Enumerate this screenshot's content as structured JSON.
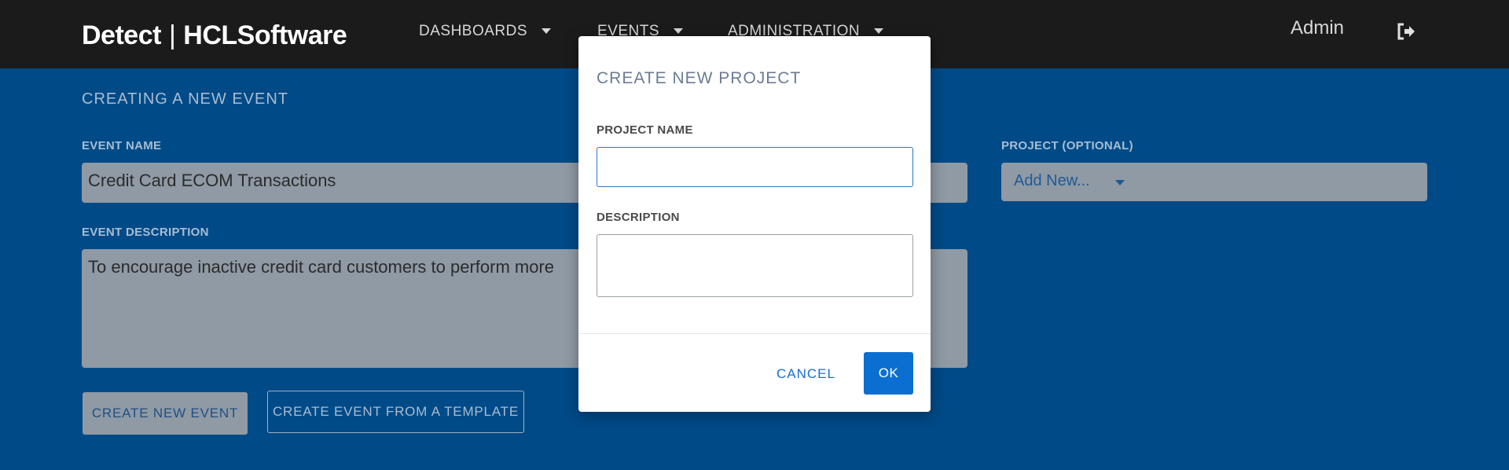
{
  "header": {
    "logo_left": "Detect",
    "logo_sep": "|",
    "logo_right": "HCLSoftware",
    "nav": [
      "DASHBOARDS",
      "EVENTS",
      "ADMINISTRATION"
    ],
    "user": "Admin",
    "logout_icon": "logout-icon"
  },
  "form": {
    "title": "CREATING A NEW EVENT",
    "event_name_label": "EVENT NAME",
    "event_name_value": "Credit Card ECOM  Transactions",
    "project_label": "PROJECT (OPTIONAL)",
    "project_value": "Add New...",
    "description_label": "EVENT DESCRIPTION",
    "description_value": "To encourage inactive credit card customers to perform more",
    "create_button": "CREATE NEW EVENT",
    "template_button": "CREATE EVENT FROM A TEMPLATE"
  },
  "modal": {
    "title": "CREATE NEW PROJECT",
    "name_label": "PROJECT NAME",
    "name_value": "",
    "description_label": "DESCRIPTION",
    "description_value": "",
    "cancel": "CANCEL",
    "ok": "OK"
  },
  "colors": {
    "header_bg": "#1b1b1b",
    "page_bg": "#004a87",
    "accent": "#0b6fd1"
  }
}
